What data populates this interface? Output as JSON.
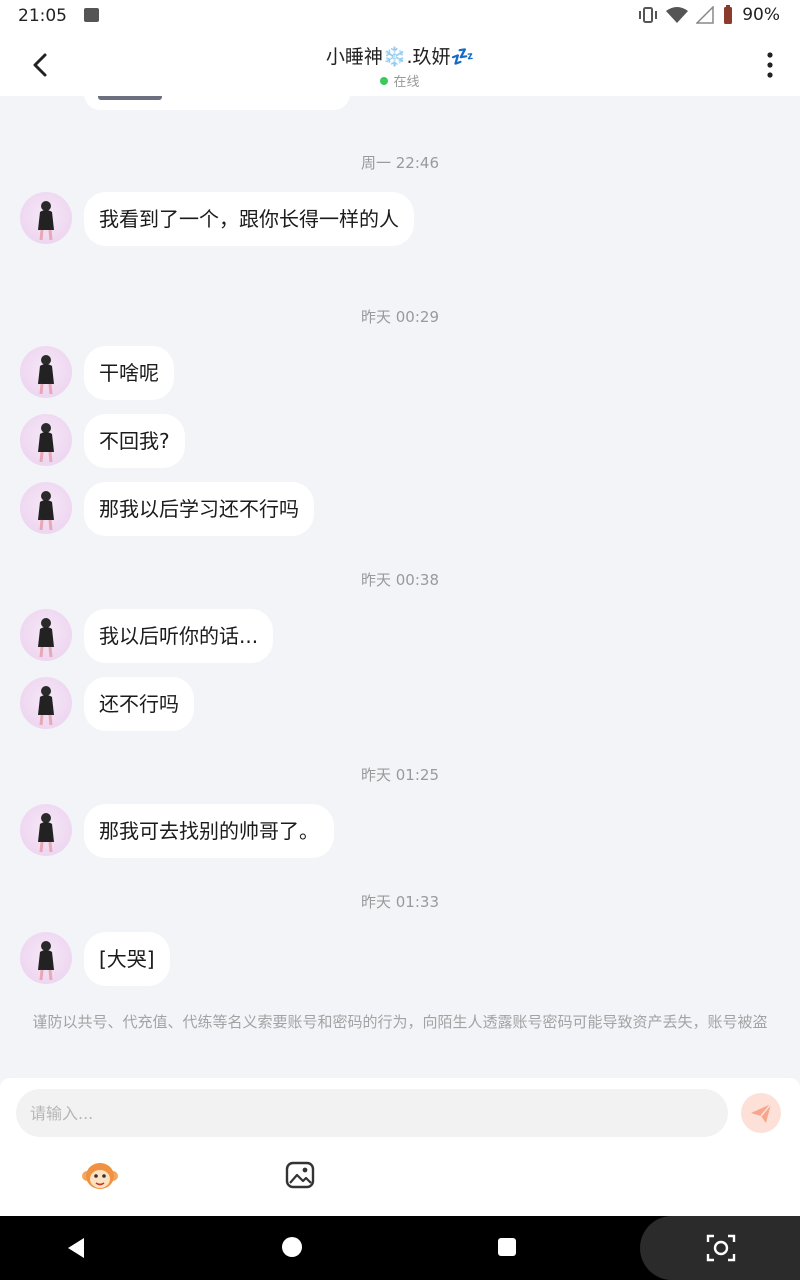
{
  "status_bar": {
    "time": "21:05",
    "battery": "90%"
  },
  "header": {
    "title": "小睡神❄️.玖妍💤",
    "status": "在线"
  },
  "messages": [
    {
      "timestamp": "周一 22:46",
      "text": "我看到了一个，跟你长得一样的人"
    },
    {
      "timestamp": "昨天 00:29",
      "text": "干啥呢"
    },
    {
      "text": "不回我?"
    },
    {
      "text": "那我以后学习还不行吗"
    },
    {
      "timestamp": "昨天 00:38",
      "text": "我以后听你的话..."
    },
    {
      "text": "还不行吗"
    },
    {
      "timestamp": "昨天 01:25",
      "text": "那我可去找别的帅哥了。"
    },
    {
      "timestamp": "昨天 01:33",
      "text": "[大哭]"
    }
  ],
  "warning": "谨防以共号、代充值、代练等名义索要账号和密码的行为，向陌生人透露账号密码可能导致资产丢失，账号被盗",
  "composer": {
    "placeholder": "请输入..."
  },
  "colors": {
    "online_dot": "#3bc95a",
    "send_button_bg": "#fde1d9",
    "send_button_icon": "#f7a58c",
    "chat_bg": "#f3f4f8"
  },
  "icons": {
    "back": "chevron-left-icon",
    "more": "vertical-dots-icon",
    "send": "paper-plane-icon",
    "emoji": "monkey-face-icon",
    "image": "image-icon"
  }
}
